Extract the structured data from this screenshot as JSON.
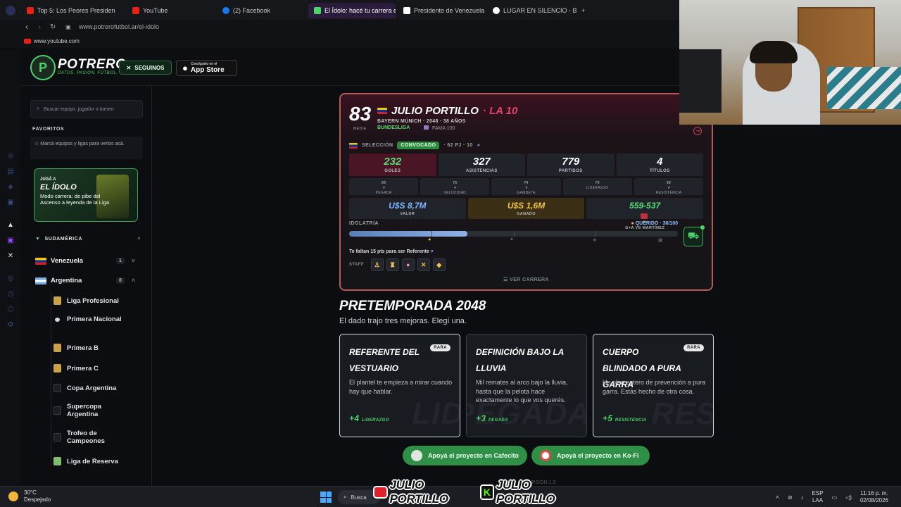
{
  "browser": {
    "tabs": [
      {
        "label": "Top 5: Los Peores Presiden",
        "color": "#e62117"
      },
      {
        "label": "YouTube",
        "color": "#e62117"
      },
      {
        "label": "(2) Facebook",
        "color": "#1877f2"
      },
      {
        "label": "El Ídolo: hacé tu carrera en",
        "color": "#4ad46b"
      },
      {
        "label": "Presidente de Venezuela -",
        "color": "#ffffff"
      },
      {
        "label": "LUGAR EN SILENCIO - Bus",
        "color": "#ffffff"
      }
    ],
    "new_tab": "+",
    "url": "www.potrerofutbol.ar/el-idolo",
    "bookmark": "www.youtube.com"
  },
  "header": {
    "logo_letter": "P",
    "brand": "POTRERO",
    "tagline": "DATOS. PASIÓN. FÚTBOL.",
    "follow_label": "SEGUINOS",
    "store_small": "Consíguelo en el",
    "store_big": "App Store"
  },
  "sidebar": {
    "search_placeholder": "Buscar equipo, jugador o torneo",
    "favorites_title": "FAVORITOS",
    "favorites_hint": "Marcá equipos y ligas para verlos acá.",
    "promo": {
      "line1": "JUGÁ A",
      "line2": "EL ÍDOLO",
      "line3": "Modo carrera: de pibe del Ascenso a leyenda de la Liga"
    },
    "region": "SUDAMÉRICA",
    "countries": [
      {
        "name": "Venezuela",
        "count": "1"
      },
      {
        "name": "Argentina",
        "count": "8"
      }
    ],
    "leagues": [
      "Liga Profesional",
      "Primera Nacional",
      "Primera B",
      "Primera C",
      "Copa Argentina",
      "Supercopa Argentina",
      "Trofeo de Campeones",
      "Liga de Reserva"
    ]
  },
  "player": {
    "ovr": "83",
    "ovr_label": "MEDIA",
    "name": "JULIO PORTILLO",
    "role": "· LA 10",
    "club_line": "BAYERN MÚNICH · 2048 · 38 AÑOS",
    "league": "BUNDESLIGA",
    "fame": "FAMA 100",
    "selection_label": "SELECCIÓN",
    "selection_badge": "CONVOCADO",
    "selection_stats": "· 62 PJ · 10",
    "stats": [
      {
        "value": "232",
        "label": "GOLES"
      },
      {
        "value": "327",
        "label": "ASISTENCIAS"
      },
      {
        "value": "779",
        "label": "PARTIDOS"
      },
      {
        "value": "4",
        "label": "TÍTULOS"
      }
    ],
    "attributes": [
      {
        "value": "85",
        "label": "PEGADA",
        "color": "#f2c14a",
        "down": true
      },
      {
        "value": "75",
        "label": "VELOCIDAD",
        "color": "#55e07a",
        "down": true
      },
      {
        "value": "74",
        "label": "GAMBETA",
        "color": "#f2c14a",
        "down": true
      },
      {
        "value": "75",
        "label": "LIDERAZGO",
        "color": "#55e07a",
        "down": false
      },
      {
        "value": "68",
        "label": "RESISTENCIA",
        "color": "#f2c14a",
        "down": true
      }
    ],
    "money": [
      {
        "value": "U$S 8,7M",
        "label": "VALOR",
        "color": "#7fb6ff"
      },
      {
        "value": "U$S 1,6M",
        "label": "GANADO",
        "color": "#f2c14a"
      },
      {
        "value": "559-537",
        "label": "G+A VS MARTÍNEZ",
        "color": "#55e07a"
      }
    ],
    "idolatry_label": "IDOLATRÍA",
    "idolatry_status": "QUERIDO · 36/100",
    "idolatry_progress": 0.36,
    "idolatry_note": "Te faltan 15 pts para ser Referente",
    "staff_label": "STAFF",
    "staff_icons": [
      "whistle-icon",
      "trophy-icon",
      "brain-icon",
      "swords-icon",
      "shield-icon"
    ],
    "view_career": "VER CARRERA"
  },
  "preseason": {
    "title": "PRETEMPORADA 2048",
    "subtitle": "El dado trajo tres mejoras. Elegí una.",
    "choices": [
      {
        "title": "REFERENTE DEL VESTUARIO",
        "rarity": "RARA",
        "desc": "El plantel te empieza a mirar cuando hay que hablar.",
        "bonus": "+4",
        "stat": "LIDERAZGO",
        "watermark": "LID"
      },
      {
        "title": "DEFINICIÓN BAJO LA LLUVIA",
        "rarity": "",
        "desc": "Mil remates al arco bajo la lluvia, hasta que la pelota hace exactamente lo que vos querés.",
        "bonus": "+3",
        "stat": "PEGADA",
        "watermark": "PEGADA"
      },
      {
        "title": "CUERPO BLINDADO A PURA GARRA",
        "rarity": "RARA",
        "desc": "Un plan entero de prevención a pura garra. Estás hecho de otra cosa.",
        "bonus": "+5",
        "stat": "RESISTENCIA",
        "watermark": "RES"
      }
    ]
  },
  "support": {
    "cafecito": "Apoyá el proyecto en Cafecito",
    "kofi": "Apoyá el proyecto en Ko-Fi"
  },
  "version": "VERSIÓN 1.3",
  "taskbar": {
    "temp": "30°C",
    "weather": "Despejado",
    "search": "Busca",
    "lang1": "ESP",
    "lang2": "LAA",
    "time": "11:16 p. m.",
    "date": "02/08/2026"
  },
  "overlay": {
    "yt_name": "JULIO PORTILLO",
    "kick_name": "JULIO PORTILLO",
    "kick_letter": "K"
  }
}
